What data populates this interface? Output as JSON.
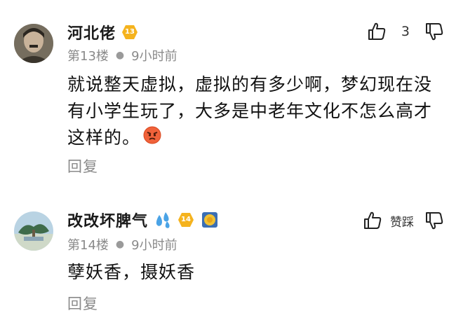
{
  "comments": [
    {
      "username": "河北佬",
      "level": "13",
      "floor": "第13楼",
      "time": "9小时前",
      "text": "就说整天虚拟，虚拟的有多少啊，梦幻现在没有小学生玩了，大多是中老年文化不怎么高才这样的。",
      "like_count": "3",
      "reply_label": "回复"
    },
    {
      "username": "改改坏脾气",
      "level": "14",
      "floor": "第14楼",
      "time": "9小时前",
      "text": "孽妖香，摄妖香",
      "vote_label": "赞踩",
      "reply_label": "回复"
    }
  ],
  "icons": {
    "like": "thumbs-up-icon",
    "dislike": "thumbs-down-icon",
    "level_badge": "hexagon-level-badge",
    "emoji": "angry-face-emoji",
    "droplets": "sweat-droplets-icon",
    "medal": "gold-medal-icon"
  },
  "colors": {
    "level_badge": "#F5B31E",
    "meta_text": "#8a8a8a",
    "body_text": "#111111"
  }
}
